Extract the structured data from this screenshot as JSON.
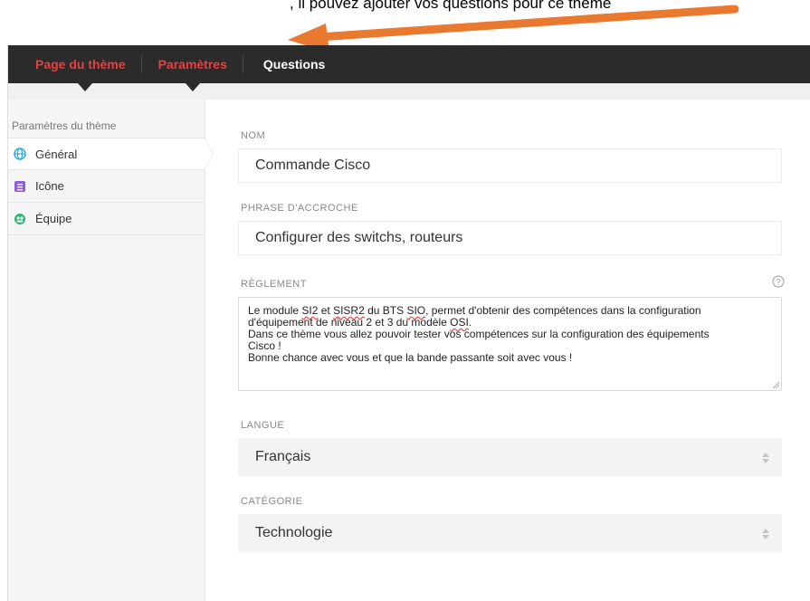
{
  "caption": {
    "text": ", il pouvez ajouter vos questions pour ce thème"
  },
  "tabs": [
    {
      "label": "Page du thème"
    },
    {
      "label": "Paramètres"
    },
    {
      "label": "Questions"
    }
  ],
  "sidebar": {
    "title": "Paramètres du thème",
    "items": [
      {
        "label": "Général",
        "icon": "globe-icon",
        "icon_color": "#29a8e0"
      },
      {
        "label": "Icône",
        "icon": "image-icon",
        "icon_color": "#8e5fd6"
      },
      {
        "label": "Équipe",
        "icon": "team-icon",
        "icon_color": "#2bb673"
      }
    ]
  },
  "form": {
    "nom": {
      "label": "NOM",
      "value": "Commande Cisco"
    },
    "phrase": {
      "label": "PHRASE D'ACCROCHE",
      "value": "Configurer des switchs, routeurs"
    },
    "reglement": {
      "label": "RÈGLEMENT",
      "line1a": "Le module ",
      "w_si2": "SI2",
      "line1b": " et ",
      "w_sisr2": "SISR2",
      "line1c": " du BTS ",
      "w_sio": "SIO",
      "line1d": ", permet d'obtenir des compétences dans la configuration",
      "line2a": "d'équipement de niveau 2 et 3 du modèle ",
      "w_osi": "OSI",
      "line2b": ".",
      "line3": "Dans ce thème vous allez pouvoir tester vos compétences sur la configuration des équipements",
      "line4": "Cisco !",
      "line5": "Bonne chance avec vous et que la bande passante soit avec vous !"
    },
    "langue": {
      "label": "LANGUE",
      "value": "Français"
    },
    "categorie": {
      "label": "CATÉGORIE",
      "value": "Technologie"
    }
  },
  "colors": {
    "topbar": "#2b2b2b",
    "tab_red": "#f03c3c",
    "arrow": "#e8792e"
  }
}
